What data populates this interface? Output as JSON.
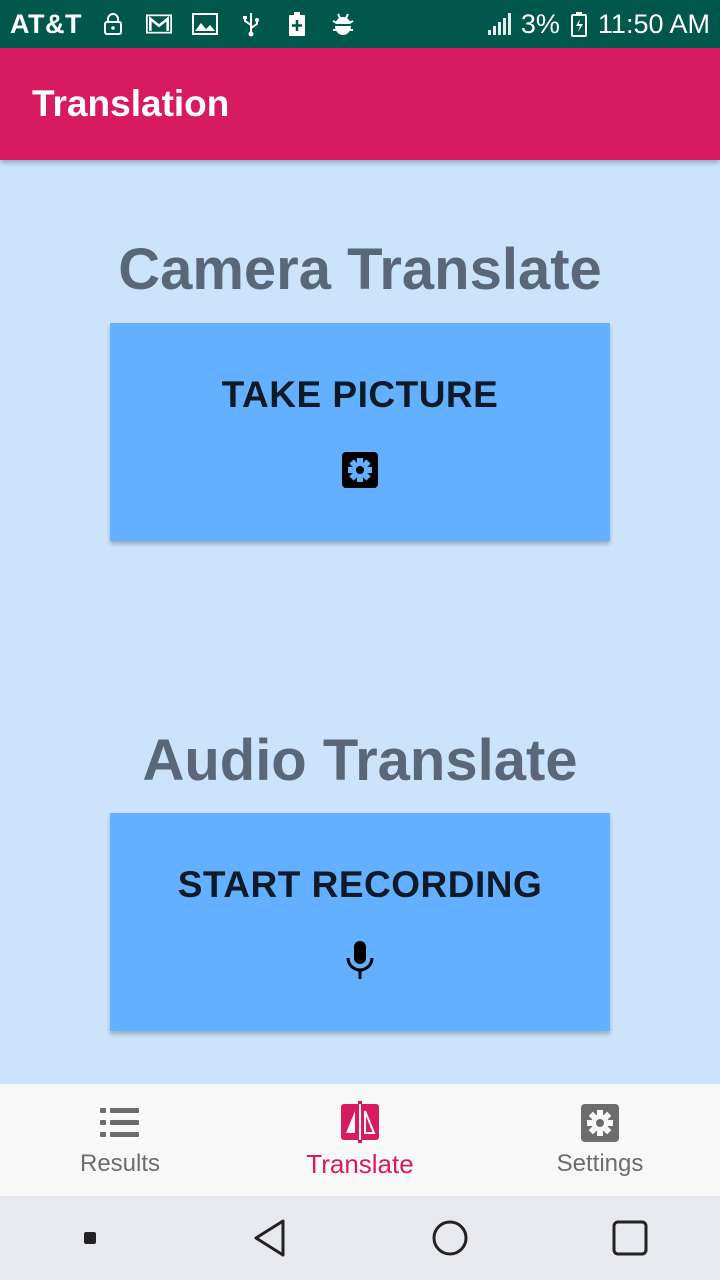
{
  "status_bar": {
    "carrier": "AT&T",
    "battery_percent": "3%",
    "time": "11:50 AM",
    "icons": [
      "lock-icon",
      "gmail-icon",
      "image-icon",
      "usb-icon",
      "battery-charging-icon",
      "android-debug-icon",
      "signal-icon",
      "battery-icon"
    ]
  },
  "app_bar": {
    "title": "Translation"
  },
  "camera": {
    "title": "Camera Translate",
    "button_label": "TAKE PICTURE",
    "icon": "camera-settings-icon"
  },
  "audio": {
    "title": "Audio Translate",
    "button_label": "START RECORDING",
    "icon": "microphone-icon"
  },
  "bottom_nav": {
    "items": [
      {
        "label": "Results",
        "icon": "list-icon",
        "active": false
      },
      {
        "label": "Translate",
        "icon": "translate-icon",
        "active": true
      },
      {
        "label": "Settings",
        "icon": "settings-icon",
        "active": false
      }
    ]
  },
  "colors": {
    "status_bar": "#01574b",
    "app_bar": "#d81b60",
    "background": "#cbe4fc",
    "card": "#62b0ff",
    "title_text": "#5a6778",
    "active_nav": "#d81b60"
  }
}
